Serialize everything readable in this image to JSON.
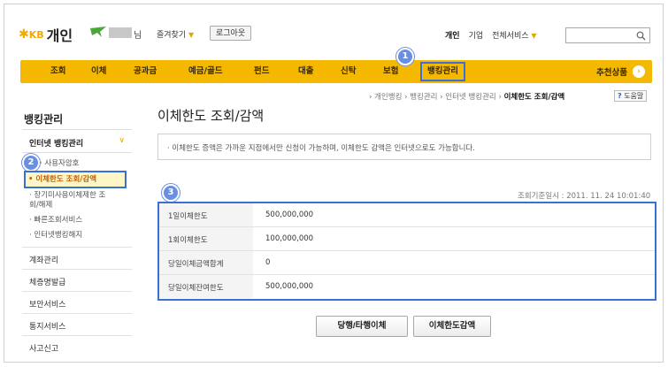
{
  "header": {
    "logo_mark": "KB",
    "logo_text": "개인",
    "user_suffix": "님",
    "favorites": "즐겨찾기",
    "logout": "로그아웃",
    "top_links": [
      "개인",
      "기업",
      "전체서비스"
    ],
    "search_placeholder": ""
  },
  "nav": {
    "items": [
      "조회",
      "이체",
      "공과금",
      "예금/골드",
      "펀드",
      "대출",
      "신탁",
      "보험",
      "뱅킹관리"
    ],
    "highlighted": "뱅킹관리",
    "recommend": "추천상품"
  },
  "badges": [
    "1",
    "2",
    "3"
  ],
  "breadcrumb": {
    "items": [
      "개인뱅킹",
      "뱅킹관리",
      "인터넷 뱅킹관리"
    ],
    "current": "이체한도 조회/감액",
    "help": "도움말"
  },
  "sidebar": {
    "title": "뱅킹관리",
    "section": "인터넷 뱅킹관리",
    "sub_items": [
      "사용자암호",
      "이체한도 조회/감액",
      "장기미사용이체제한 조회/해제",
      "빠른조회서비스",
      "인터넷뱅킹해지"
    ],
    "items": [
      "계좌관리",
      "체증명발급",
      "보안서비스",
      "통지서비스",
      "사고신고"
    ]
  },
  "main": {
    "title": "이체한도 조회/감액",
    "notice": "· 이체한도 증액은 가까운 지점에서만 신청이 가능하며, 이체한도 감액은 인터넷으로도 가능합니다.",
    "ref_time": "조회기준일시 : 2011. 11. 24 10:01:40",
    "rows": [
      {
        "label": "1일이체한도",
        "value": "500,000,000"
      },
      {
        "label": "1회이체한도",
        "value": "100,000,000"
      },
      {
        "label": "당일이체금액합계",
        "value": "0"
      },
      {
        "label": "당일이체잔여한도",
        "value": "500,000,000"
      }
    ],
    "buttons": [
      "당행/타행이체",
      "이체한도감액"
    ]
  }
}
